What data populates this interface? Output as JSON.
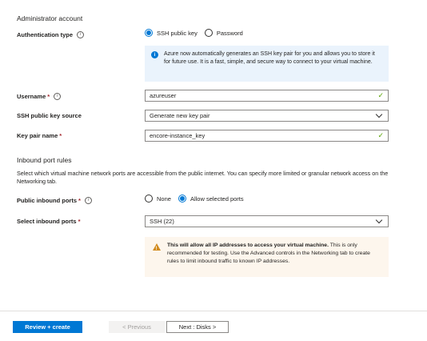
{
  "admin": {
    "heading": "Administrator account",
    "auth_type_label": "Authentication type",
    "auth_options": [
      "SSH public key",
      "Password"
    ],
    "auth_selected": "SSH public key",
    "info_text": "Azure now automatically generates an SSH key pair for you and allows you to store it for future use. It is a fast, simple, and secure way to connect to your virtual machine.",
    "username_label": "Username",
    "username_value": "azureuser",
    "ssh_source_label": "SSH public key source",
    "ssh_source_value": "Generate new key pair",
    "key_pair_label": "Key pair name",
    "key_pair_value": "encore-instance_key"
  },
  "inbound": {
    "heading": "Inbound port rules",
    "description": "Select which virtual machine network ports are accessible from the public internet. You can specify more limited or granular network access on the Networking tab.",
    "public_ports_label": "Public inbound ports",
    "public_options": [
      "None",
      "Allow selected ports"
    ],
    "public_selected": "Allow selected ports",
    "select_ports_label": "Select inbound ports",
    "select_ports_value": "SSH (22)",
    "warning_bold": "This will allow all IP addresses to access your virtual machine.",
    "warning_text": " This is only recommended for testing.  Use the Advanced controls in the Networking tab to create rules to limit inbound traffic to known IP addresses."
  },
  "footer": {
    "review_label": "Review + create",
    "previous_label": "< Previous",
    "next_label": "Next : Disks >"
  },
  "icons": {
    "info": "info-icon",
    "check": "checkmark-icon",
    "chevron": "chevron-down-icon",
    "warning": "warning-icon"
  },
  "colors": {
    "accent": "#0078d4",
    "valid": "#57a300",
    "warning": "#d18b1f",
    "required": "#a4262c"
  }
}
